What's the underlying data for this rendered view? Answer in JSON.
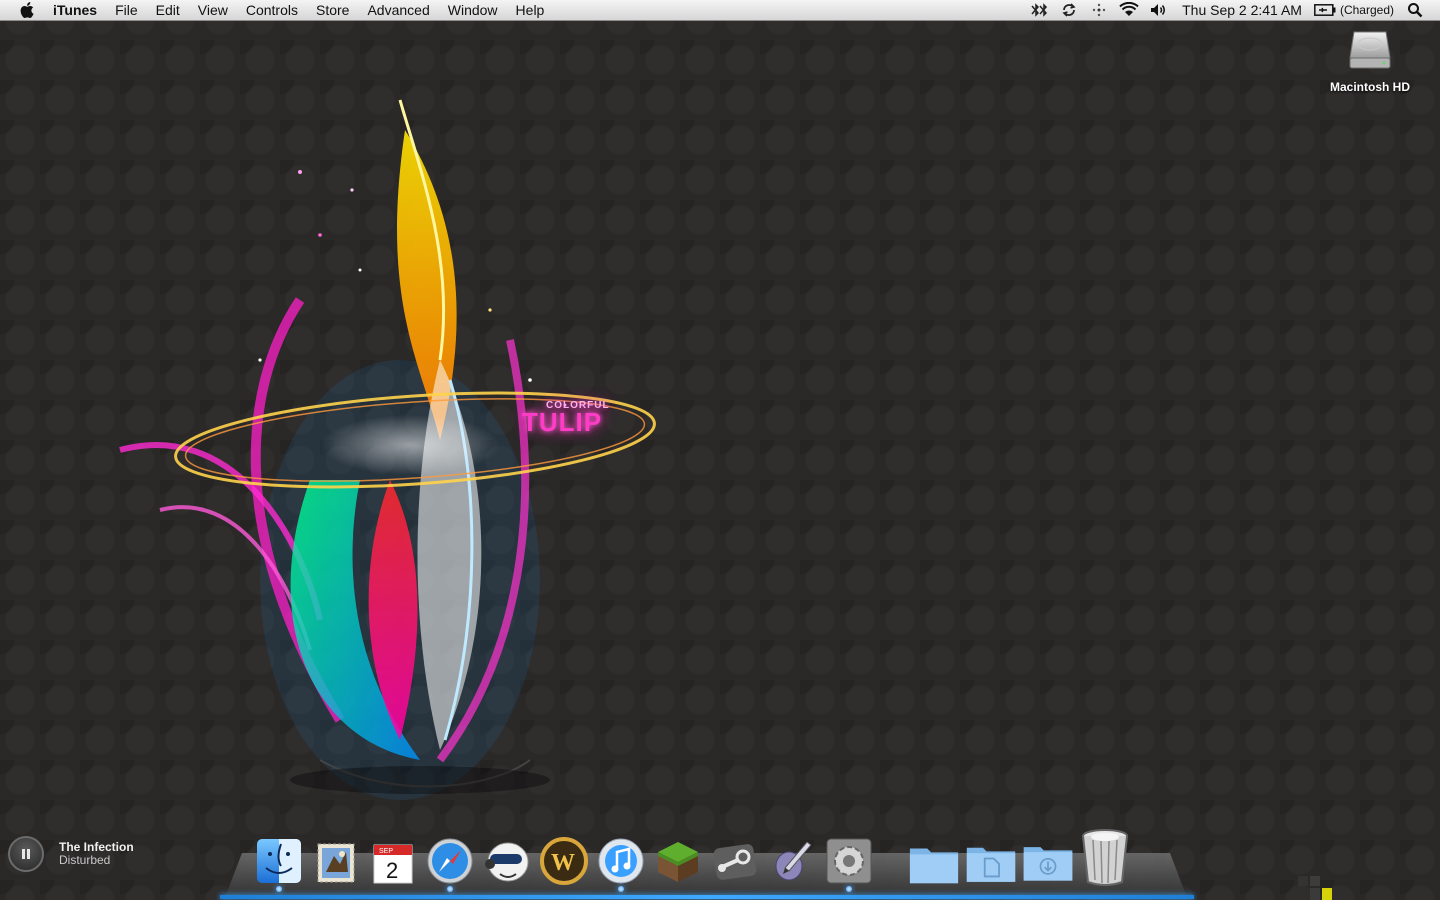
{
  "menubar": {
    "app_name": "iTunes",
    "menus": [
      "File",
      "Edit",
      "View",
      "Controls",
      "Store",
      "Advanced",
      "Window",
      "Help"
    ],
    "status_icons": [
      "bluetooth-icon",
      "sync-icon",
      "activity-icon",
      "wifi-icon",
      "volume-icon"
    ],
    "clock": "Thu Sep 2  2:41 AM",
    "battery": "(Charged)"
  },
  "desktop": {
    "drive_label": "Macintosh HD",
    "wallpaper": {
      "title_small": "COLORFUL",
      "title_big": "TULIP"
    }
  },
  "now_playing": {
    "title": "The Infection",
    "artist": "Disturbed",
    "state": "playing"
  },
  "dock": {
    "calendar_month": "SEP",
    "calendar_day": "2",
    "apps": [
      "finder-icon",
      "mail-icon",
      "ical-icon",
      "safari-icon",
      "adium-icon",
      "world-of-warcraft-icon",
      "itunes-icon",
      "minecraft-icon",
      "steam-icon",
      "script-editor-icon",
      "system-preferences-icon"
    ],
    "folders": [
      "applications-folder-icon",
      "documents-folder-icon",
      "downloads-folder-icon"
    ],
    "trash": "trash-icon"
  },
  "colors": {
    "desktop_bg": "#2b2828",
    "dock_indicator": "#3fa8ff"
  }
}
